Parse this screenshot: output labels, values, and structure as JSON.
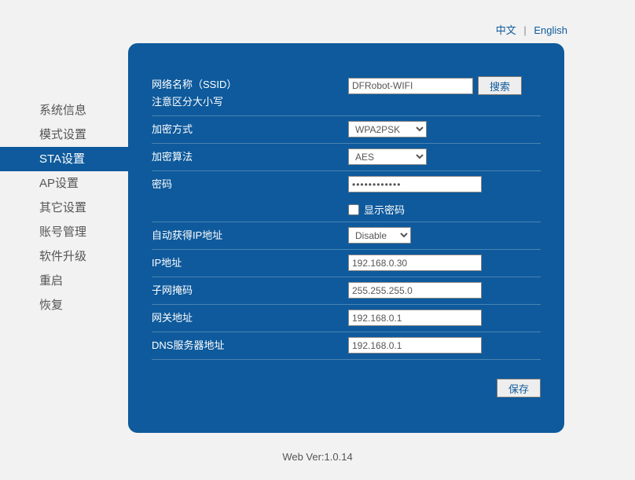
{
  "lang": {
    "zh": "中文",
    "en": "English"
  },
  "sidebar": {
    "items": [
      {
        "label": "系统信息"
      },
      {
        "label": "模式设置"
      },
      {
        "label": "STA设置"
      },
      {
        "label": "AP设置"
      },
      {
        "label": "其它设置"
      },
      {
        "label": "账号管理"
      },
      {
        "label": "软件升级"
      },
      {
        "label": "重启"
      },
      {
        "label": "恢复"
      }
    ],
    "active_index": 2
  },
  "form": {
    "ssid_label": "网络名称（SSID）",
    "ssid_note": "注意区分大小写",
    "ssid_value": "DFRobot-WIFI",
    "search_btn": "搜索",
    "enc_method_label": "加密方式",
    "enc_method_value": "WPA2PSK",
    "enc_algo_label": "加密算法",
    "enc_algo_value": "AES",
    "password_label": "密码",
    "password_value": "••••••••••••",
    "show_password": "显示密码",
    "dhcp_label": "自动获得IP地址",
    "dhcp_value": "Disable",
    "ip_label": "IP地址",
    "ip_value": "192.168.0.30",
    "mask_label": "子网掩码",
    "mask_value": "255.255.255.0",
    "gateway_label": "网关地址",
    "gateway_value": "192.168.0.1",
    "dns_label": "DNS服务器地址",
    "dns_value": "192.168.0.1",
    "save_btn": "保存"
  },
  "footer": "Web Ver:1.0.14"
}
